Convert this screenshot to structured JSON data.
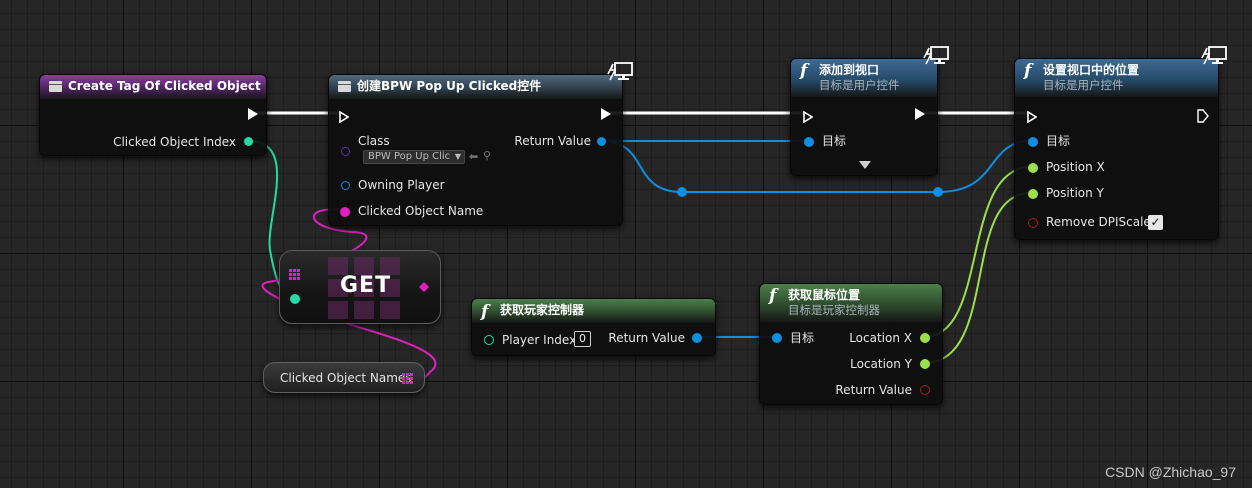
{
  "colors": {
    "exec": "#ffffff",
    "object": "#0b8fe0",
    "int": "#22dca3",
    "name": "#e11fc0",
    "float": "#9be04a",
    "bool": "#a21e1e",
    "class": "#5a2bb3"
  },
  "nodes": {
    "event": {
      "title": "Create Tag Of Clicked Object",
      "icon": "event-box-icon",
      "pins": {
        "clicked_object_index": "Clicked Object Index"
      }
    },
    "create_widget": {
      "title": "创建BPW Pop Up Clicked控件",
      "icon": "widget-box-icon",
      "pins": {
        "class": "Class",
        "class_value": "BPW Pop Up Clic",
        "owning_player": "Owning Player",
        "clicked_object_name": "Clicked Object Name",
        "return_value": "Return Value"
      }
    },
    "add_to_viewport": {
      "title": "添加到视口",
      "subtitle": "目标是用户控件",
      "icon": "function-icon",
      "pins": {
        "target": "目标"
      }
    },
    "set_position": {
      "title": "设置视口中的位置",
      "subtitle": "目标是用户控件",
      "icon": "function-icon",
      "pins": {
        "target": "目标",
        "position_x": "Position X",
        "position_y": "Position Y",
        "remove_dpi_scale": "Remove DPIScale",
        "remove_dpi_scale_checked": true
      }
    },
    "get": {
      "title": "GET"
    },
    "clicked_object_names": {
      "label": "Clicked Object Names"
    },
    "get_player_controller": {
      "title": "获取玩家控制器",
      "icon": "function-icon",
      "pins": {
        "player_index": "Player Index",
        "player_index_value": "0",
        "return_value": "Return Value"
      }
    },
    "get_mouse_position": {
      "title": "获取鼠标位置",
      "subtitle": "目标是玩家控制器",
      "icon": "function-icon",
      "pins": {
        "target": "目标",
        "location_x": "Location X",
        "location_y": "Location Y",
        "return_value": "Return Value"
      }
    }
  },
  "watermark": "CSDN @Zhichao_97"
}
